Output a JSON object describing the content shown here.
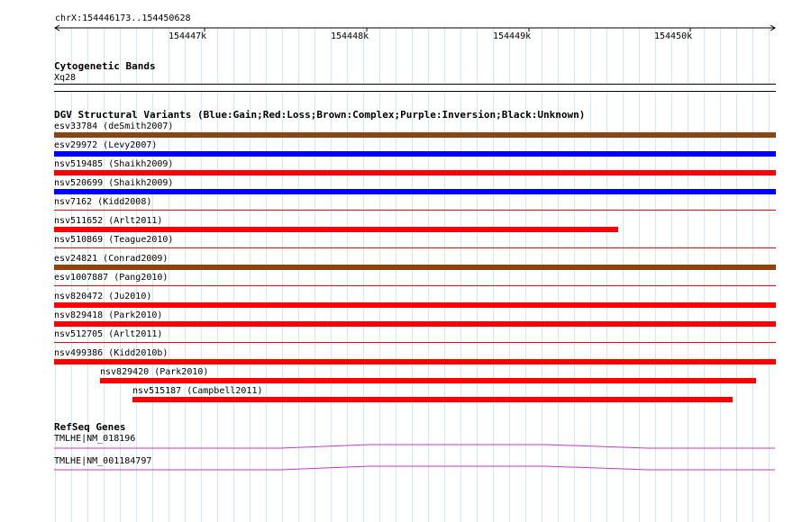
{
  "ruler": {
    "location": "chrX:154446173..154450628",
    "ticks": [
      "154447k",
      "154448k",
      "154449k",
      "154450k"
    ]
  },
  "tracks": {
    "cytoband": {
      "title": "Cytogenetic Bands",
      "band": "Xq28"
    },
    "dgv": {
      "title": "DGV Structural Variants (Blue:Gain;Red:Loss;Brown:Complex;Purple:Inversion;Black:Unknown)",
      "colors": {
        "gain": "#0000ee",
        "loss": "#ff0000",
        "complex": "#8b4513"
      },
      "variants": [
        {
          "label": "esv33784 (deSmith2007)",
          "type": "complex"
        },
        {
          "label": "esv29972 (Levy2007)",
          "type": "gain"
        },
        {
          "label": "nsv519485 (Shaikh2009)",
          "type": "loss"
        },
        {
          "label": "nsv520699 (Shaikh2009)",
          "type": "gain"
        },
        {
          "label": "nsv7162 (Kidd2008)",
          "type": "loss"
        },
        {
          "label": "nsv511652 (Arlt2011)",
          "type": "loss"
        },
        {
          "label": "nsv510869 (Teague2010)",
          "type": "loss"
        },
        {
          "label": "esv24821 (Conrad2009)",
          "type": "complex"
        },
        {
          "label": "esv1007887 (Pang2010)",
          "type": "loss"
        },
        {
          "label": "nsv820472 (Ju2010)",
          "type": "loss"
        },
        {
          "label": "nsv829418 (Park2010)",
          "type": "loss"
        },
        {
          "label": "nsv512705 (Arlt2011)",
          "type": "loss"
        },
        {
          "label": "nsv499386 (Kidd2010b)",
          "type": "loss"
        },
        {
          "label": "nsv829420 (Park2010)",
          "type": "loss"
        },
        {
          "label": "nsv515187 (Campbell2011)",
          "type": "loss"
        }
      ]
    },
    "refseq": {
      "title": "RefSeq Genes",
      "color": "#cc33cc",
      "genes": [
        {
          "label": "TMLHE|NM_018196"
        },
        {
          "label": "TMLHE|NM_001184797"
        }
      ]
    }
  }
}
